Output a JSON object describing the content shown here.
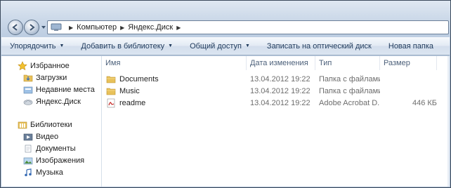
{
  "address": {
    "crumbs": [
      "Компьютер",
      "Яндекс.Диск"
    ]
  },
  "toolbar": {
    "organize": "Упорядочить",
    "add_to_library": "Добавить в библиотеку",
    "share": "Общий доступ",
    "burn": "Записать на оптический диск",
    "new_folder": "Новая папка"
  },
  "sidebar": {
    "favorites": {
      "label": "Избранное",
      "items": [
        "Загрузки",
        "Недавние места",
        "Яндекс.Диск"
      ]
    },
    "libraries": {
      "label": "Библиотеки",
      "items": [
        "Видео",
        "Документы",
        "Изображения",
        "Музыка"
      ]
    }
  },
  "columns": {
    "name": "Имя",
    "modified": "Дата изменения",
    "type": "Тип",
    "size": "Размер"
  },
  "files": [
    {
      "name": "Documents",
      "modified": "13.04.2012 19:22",
      "type": "Папка с файлами",
      "size": "",
      "icon": "folder-icon"
    },
    {
      "name": "Music",
      "modified": "13.04.2012 19:22",
      "type": "Папка с файлами",
      "size": "",
      "icon": "folder-icon"
    },
    {
      "name": "readme",
      "modified": "13.04.2012 19:22",
      "type": "Adobe Acrobat D...",
      "size": "446 КБ",
      "icon": "pdf-icon"
    }
  ],
  "colors": {
    "toolbar_text": "#1e395b",
    "column_header_text": "#4c607a",
    "folder_yellow": "#e8c15a"
  }
}
